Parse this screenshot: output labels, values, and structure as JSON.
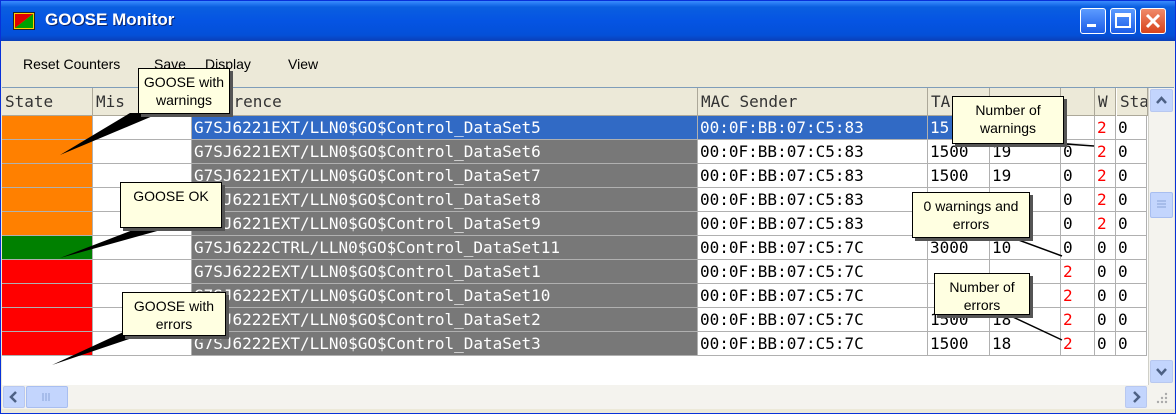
{
  "window": {
    "title": "GOOSE Monitor"
  },
  "menu": {
    "items": [
      "Reset Counters",
      "Save",
      "Display",
      "View"
    ]
  },
  "columns": [
    "State",
    "Mis",
    "Reference",
    "MAC Sender",
    "TA",
    "",
    "",
    "W",
    "Sta"
  ],
  "rows": [
    {
      "state_color": "#ff8000",
      "ref": "G7SJ6221EXT/LLN0$GO$Control_DataSet5",
      "mac": "00:0F:BB:07:C5:83",
      "ta1": "15",
      "ta2": "",
      "e": "",
      "w": "2",
      "st": "0",
      "selected": true
    },
    {
      "state_color": "#ff8000",
      "ref": "G7SJ6221EXT/LLN0$GO$Control_DataSet6",
      "mac": "00:0F:BB:07:C5:83",
      "ta1": "1500",
      "ta2": "19",
      "e": "0",
      "w": "2",
      "st": "0"
    },
    {
      "state_color": "#ff8000",
      "ref": "G7SJ6221EXT/LLN0$GO$Control_DataSet7",
      "mac": "00:0F:BB:07:C5:83",
      "ta1": "1500",
      "ta2": "19",
      "e": "0",
      "w": "2",
      "st": "0"
    },
    {
      "state_color": "#ff8000",
      "ref": "G7SJ6221EXT/LLN0$GO$Control_DataSet8",
      "mac": "00:0F:BB:07:C5:83",
      "ta1": "",
      "ta2": "",
      "e": "0",
      "w": "2",
      "st": "0"
    },
    {
      "state_color": "#ff8000",
      "ref": "G7SJ6221EXT/LLN0$GO$Control_DataSet9",
      "mac": "00:0F:BB:07:C5:83",
      "ta1": "",
      "ta2": "",
      "e": "0",
      "w": "2",
      "st": "0"
    },
    {
      "state_color": "#008000",
      "ref": "G7SJ6222CTRL/LLN0$GO$Control_DataSet11",
      "mac": "00:0F:BB:07:C5:7C",
      "ta1": "3000",
      "ta2": "10",
      "e": "0",
      "w": "0",
      "st": "0"
    },
    {
      "state_color": "#ff0000",
      "ref": "G7SJ6222EXT/LLN0$GO$Control_DataSet1",
      "mac": "00:0F:BB:07:C5:7C",
      "ta1": "",
      "ta2": "",
      "e": "2",
      "w": "0",
      "st": "0"
    },
    {
      "state_color": "#ff0000",
      "ref": "G7SJ6222EXT/LLN0$GO$Control_DataSet10",
      "mac": "00:0F:BB:07:C5:7C",
      "ta1": "",
      "ta2": "",
      "e": "2",
      "w": "0",
      "st": "0"
    },
    {
      "state_color": "#ff0000",
      "ref": "G7SJ6222EXT/LLN0$GO$Control_DataSet2",
      "mac": "00:0F:BB:07:C5:7C",
      "ta1": "1500",
      "ta2": "18",
      "e": "2",
      "w": "0",
      "st": "0"
    },
    {
      "state_color": "#ff0000",
      "ref": "G7SJ6222EXT/LLN0$GO$Control_DataSet3",
      "mac": "00:0F:BB:07:C5:7C",
      "ta1": "1500",
      "ta2": "18",
      "e": "2",
      "w": "0",
      "st": "0"
    }
  ],
  "callouts": {
    "warnings": "GOOSE with warnings",
    "ok": "GOOSE OK",
    "errors": "GOOSE with errors",
    "num_warnings": "Number of warnings",
    "zero": "0 warnings and errors",
    "num_errors": "Number of errors"
  },
  "colors": {
    "titlebar": "#0554e3",
    "selection": "#316ac5",
    "reference_bg": "#787878",
    "error_text": "#ff0000"
  }
}
